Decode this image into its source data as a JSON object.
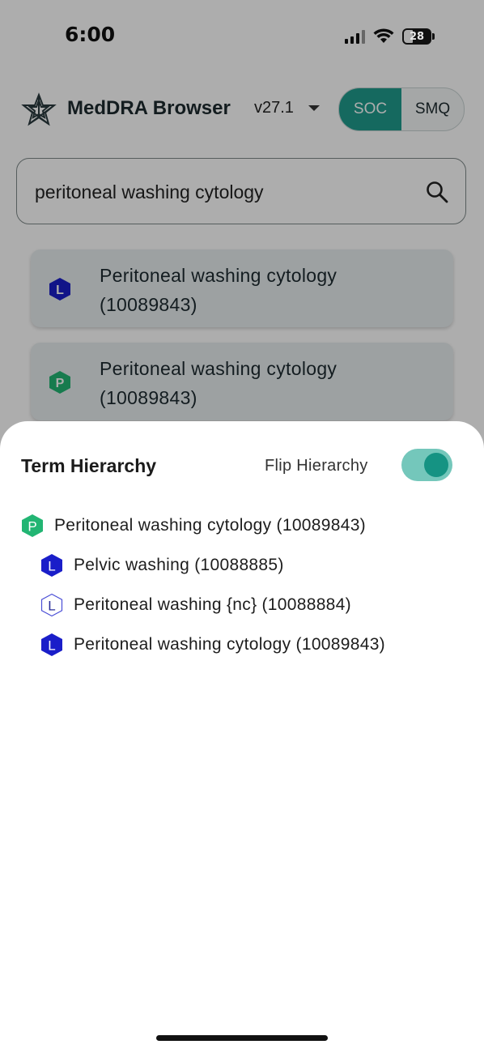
{
  "status_bar": {
    "time": "6:00",
    "battery": "28"
  },
  "header": {
    "title": "MedDRA Browser",
    "version": "v27.1",
    "segments": [
      "SOC",
      "SMQ"
    ],
    "active_segment": "SOC"
  },
  "search": {
    "value": "peritoneal washing cytology"
  },
  "results": [
    {
      "badge": "L",
      "line1": "Peritoneal washing cytology",
      "line2": "(10089843)"
    },
    {
      "badge": "P",
      "line1": "Peritoneal washing cytology",
      "line2": "(10089843)"
    }
  ],
  "sheet": {
    "title": "Term Hierarchy",
    "flip_label": "Flip Hierarchy",
    "flip_on": true,
    "tree": [
      {
        "badge": "P",
        "style": "green-filled",
        "label": "Peritoneal washing cytology (10089843)"
      },
      {
        "badge": "L",
        "style": "blue-filled",
        "label": "Pelvic washing (10088885)"
      },
      {
        "badge": "L",
        "style": "blue-outline",
        "label": "Peritoneal washing {nc} (10088884)"
      },
      {
        "badge": "L",
        "style": "blue-filled",
        "label": "Peritoneal washing cytology (10089843)"
      }
    ]
  },
  "colors": {
    "teal": "#1f9b8c",
    "llt_blue": "#1a1ec9",
    "pt_green": "#22b573"
  }
}
